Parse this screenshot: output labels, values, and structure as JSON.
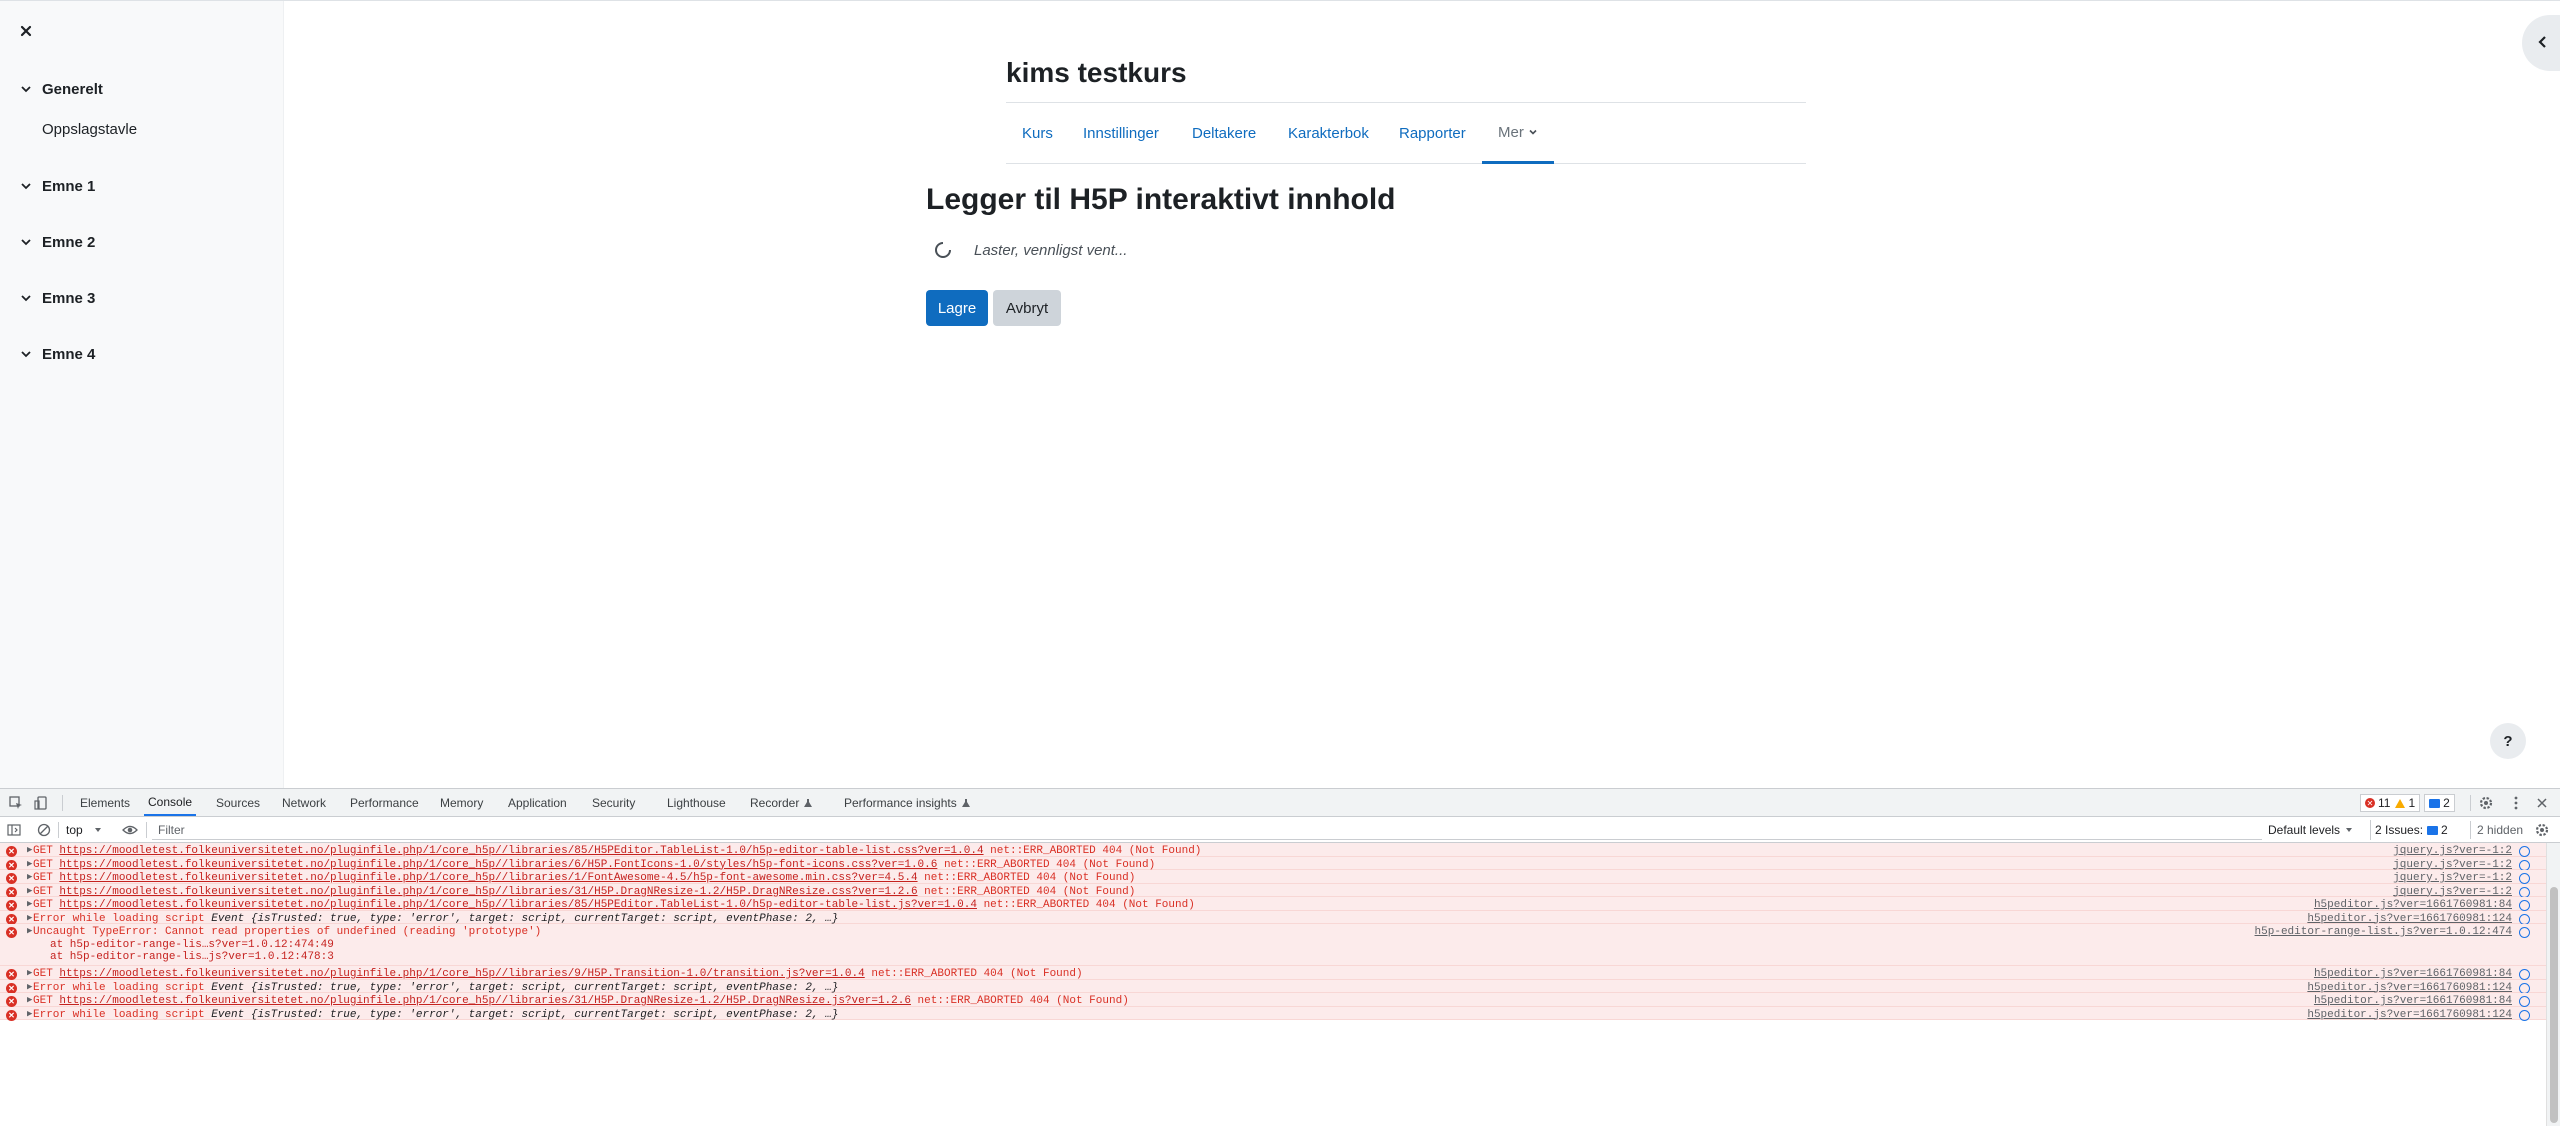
{
  "drawer": {
    "sections": [
      {
        "label": "Generelt",
        "items": [
          "Oppslagstavle"
        ]
      },
      {
        "label": "Emne 1",
        "items": []
      },
      {
        "label": "Emne 2",
        "items": []
      },
      {
        "label": "Emne 3",
        "items": []
      },
      {
        "label": "Emne 4",
        "items": []
      }
    ]
  },
  "course": {
    "title": "kims testkurs",
    "nav": [
      "Kurs",
      "Innstillinger",
      "Deltakere",
      "Karakterbok",
      "Rapporter",
      "Mer"
    ]
  },
  "main": {
    "heading": "Legger til H5P interaktivt innhold",
    "loading": "Laster, vennligst vent...",
    "save_label": "Lagre",
    "cancel_label": "Avbryt",
    "help_label": "?"
  },
  "devtools": {
    "tabs": [
      "Elements",
      "Console",
      "Sources",
      "Network",
      "Performance",
      "Memory",
      "Application",
      "Security",
      "Lighthouse",
      "Recorder",
      "Performance insights"
    ],
    "active_tab": "Console",
    "errors_count": "11",
    "warnings_count": "1",
    "messages_count": "2",
    "context": "top",
    "filter_placeholder": "Filter",
    "levels": "Default levels",
    "issues_label": "2 Issues:",
    "issues_count": "2",
    "hidden": "2 hidden",
    "colors": {
      "error": "#d93025",
      "error_bg": "#fcebeb",
      "accent": "#1a73e8"
    }
  },
  "console": {
    "rows": [
      {
        "prefix": "GET ",
        "url": "https://moodletest.folkeuniversitetet.no/pluginfile.php/1/core_h5p//libraries/85/H5PEditor.TableList-1.0/h5p-editor-table-list.css?ver=1.0.4",
        "suffix": " net::ERR_ABORTED 404 (Not Found)",
        "src": "jquery.js?ver=-1:2"
      },
      {
        "prefix": "GET ",
        "url": "https://moodletest.folkeuniversitetet.no/pluginfile.php/1/core_h5p//libraries/6/H5P.FontIcons-1.0/styles/h5p-font-icons.css?ver=1.0.6",
        "suffix": " net::ERR_ABORTED 404 (Not Found)",
        "src": "jquery.js?ver=-1:2"
      },
      {
        "prefix": "GET ",
        "url": "https://moodletest.folkeuniversitetet.no/pluginfile.php/1/core_h5p//libraries/1/FontAwesome-4.5/h5p-font-awesome.min.css?ver=4.5.4",
        "suffix": " net::ERR_ABORTED 404 (Not Found)",
        "src": "jquery.js?ver=-1:2"
      },
      {
        "prefix": "GET ",
        "url": "https://moodletest.folkeuniversitetet.no/pluginfile.php/1/core_h5p//libraries/31/H5P.DragNResize-1.2/H5P.DragNResize.css?ver=1.2.6",
        "suffix": " net::ERR_ABORTED 404 (Not Found)",
        "src": "jquery.js?ver=-1:2"
      },
      {
        "prefix": "GET ",
        "url": "https://moodletest.folkeuniversitetet.no/pluginfile.php/1/core_h5p//libraries/85/H5PEditor.TableList-1.0/h5p-editor-table-list.js?ver=1.0.4",
        "suffix": " net::ERR_ABORTED 404 (Not Found)",
        "src": "h5peditor.js?ver=1661760981:84"
      },
      {
        "prefix": "Error while loading script ",
        "obj": "Event {isTrusted: true, type: 'error', target: script, currentTarget: script, eventPhase: 2, …}",
        "src": "h5peditor.js?ver=1661760981:124"
      },
      {
        "prefix": "Uncaught TypeError: Cannot read properties of undefined (reading 'prototype')",
        "trace": [
          "at h5p-editor-range-lis…s?ver=1.0.12:474:49",
          "at h5p-editor-range-lis…js?ver=1.0.12:478:3"
        ],
        "src": "h5p-editor-range-list.js?ver=1.0.12:474"
      },
      {
        "prefix": "GET ",
        "url": "https://moodletest.folkeuniversitetet.no/pluginfile.php/1/core_h5p//libraries/9/H5P.Transition-1.0/transition.js?ver=1.0.4",
        "suffix": " net::ERR_ABORTED 404 (Not Found)",
        "src": "h5peditor.js?ver=1661760981:84"
      },
      {
        "prefix": "Error while loading script ",
        "obj": "Event {isTrusted: true, type: 'error', target: script, currentTarget: script, eventPhase: 2, …}",
        "src": "h5peditor.js?ver=1661760981:124"
      },
      {
        "prefix": "GET ",
        "url": "https://moodletest.folkeuniversitetet.no/pluginfile.php/1/core_h5p//libraries/31/H5P.DragNResize-1.2/H5P.DragNResize.js?ver=1.2.6",
        "suffix": " net::ERR_ABORTED 404 (Not Found)",
        "src": "h5peditor.js?ver=1661760981:84"
      },
      {
        "prefix": "Error while loading script ",
        "obj": "Event {isTrusted: true, type: 'error', target: script, currentTarget: script, eventPhase: 2, …}",
        "src": "h5peditor.js?ver=1661760981:124"
      }
    ]
  }
}
